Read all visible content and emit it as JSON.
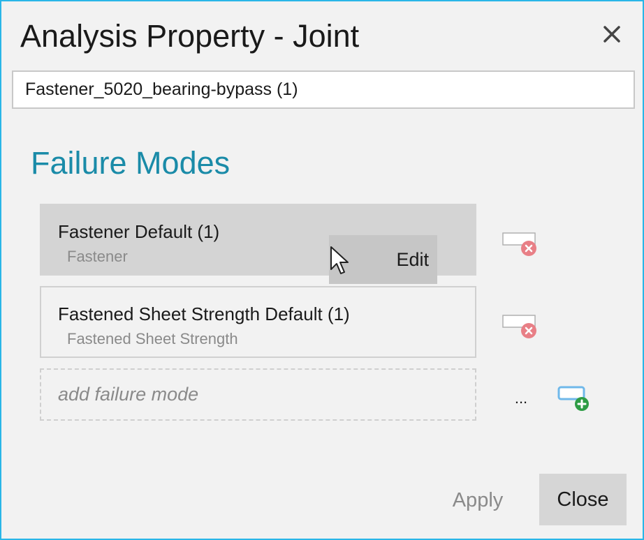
{
  "dialog": {
    "title": "Analysis Property - Joint",
    "accent_color": "#29b6e8"
  },
  "name_field": {
    "value": "Fastener_5020_bearing-bypass (1)"
  },
  "failure_modes": {
    "section_title": "Failure Modes",
    "section_color": "#1a8ba8",
    "items": [
      {
        "name": "Fastener Default (1)",
        "type": "Fastener",
        "selected": true
      },
      {
        "name": "Fastened Sheet Strength Default (1)",
        "type": "Fastened Sheet Strength",
        "selected": false
      }
    ],
    "edit_label": "Edit",
    "add_placeholder": "add failure mode",
    "more_label": "...",
    "remove_icon": "remove-item-icon",
    "add_icon": "add-item-icon"
  },
  "footer": {
    "apply_label": "Apply",
    "close_label": "Close"
  }
}
